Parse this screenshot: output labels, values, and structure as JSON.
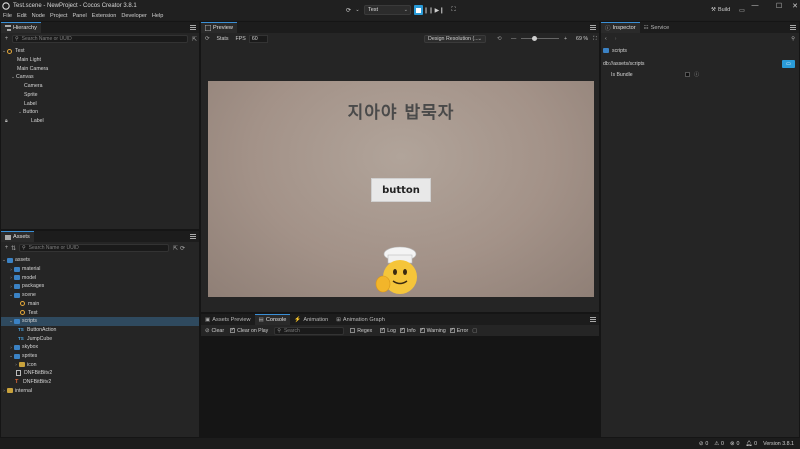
{
  "window": {
    "title": "Test.scene - NewProject - Cocos Creator 3.8.1"
  },
  "menu": [
    "File",
    "Edit",
    "Node",
    "Project",
    "Panel",
    "Extension",
    "Developer",
    "Help"
  ],
  "toolbar": {
    "scene_select": "Test",
    "build_label": "Build"
  },
  "hierarchy": {
    "tab": "Hierarchy",
    "search_placeholder": "Search Name or UUID",
    "nodes": [
      "Test",
      "Main Light",
      "Main Camera",
      "Canvas",
      "Camera",
      "Sprite",
      "Label",
      "Button",
      "Label"
    ]
  },
  "assets": {
    "tab": "Assets",
    "search_placeholder": "Search Name or UUID",
    "items": [
      "assets",
      "material",
      "model",
      "packages",
      "scene",
      "main",
      "Test",
      "scripts",
      "ButtonAction",
      "JumpCube",
      "skybox",
      "sprites",
      "icon",
      "DNF⁠BitBitv2",
      "DNF⁠BitBitv2",
      "internal"
    ]
  },
  "preview": {
    "tab": "Preview",
    "stats_label": "Stats",
    "fps_label": "FPS",
    "fps_value": "60",
    "design_resolution": "Design Resolution (...",
    "zoom": "69 %",
    "heading": "지아야 밥묵자",
    "button_text": "button"
  },
  "console": {
    "tabs": [
      "Assets Preview",
      "Console",
      "Animation",
      "Animation Graph"
    ],
    "clear": "Clear",
    "clear_on_play": "Clear on Play",
    "search_placeholder": "Search",
    "regex": "Regex",
    "filters": [
      "Log",
      "Info",
      "Warning",
      "Error"
    ]
  },
  "inspector": {
    "tabs": [
      "Inspector",
      "Service"
    ],
    "folder_name": "scripts",
    "path": "db://assets/scripts",
    "is_bundle_label": "Is Bundle"
  },
  "status": {
    "errors": "0",
    "warnings": "0",
    "infos": "0",
    "messages": "0",
    "version": "Version 3.8.1"
  },
  "colors": {
    "accent": "#2a9bd8",
    "selection": "#2f4a5f",
    "panel": "#252525",
    "preview_bg": "#a39288"
  }
}
